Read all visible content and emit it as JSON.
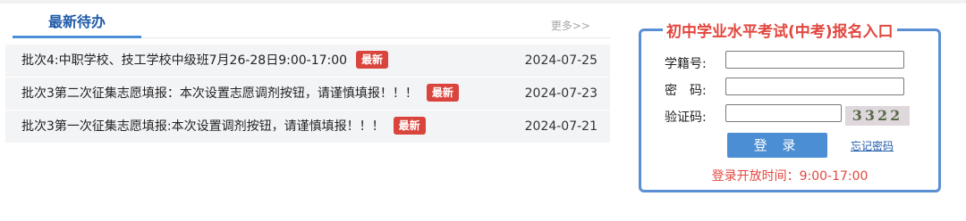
{
  "news": {
    "title": "最新待办",
    "more_label": "更多>>",
    "items": [
      {
        "title": "批次4:中职学校、技工学校中级班7月26-28日9:00-17:00",
        "badge": "最新",
        "date": "2024-07-25"
      },
      {
        "title": "批次3第二次征集志愿填报：本次设置志愿调剂按钮，请谨慎填报！！！",
        "badge": "最新",
        "date": "2024-07-23"
      },
      {
        "title": "批次3第一次征集志愿填报:本次设置调剂按钮，请谨慎填报！！！",
        "badge": "最新",
        "date": "2024-07-21"
      }
    ]
  },
  "registration": {
    "title": "初中学业水平考试(中考)报名入口",
    "student_id_label": "学籍号:",
    "password_label": "密　码:",
    "captcha_label": "验证码:",
    "captcha_text": "3322",
    "login_label": "登 录",
    "forgot_label": "忘记密码",
    "open_time": "登录开放时间：9:00-17:00"
  },
  "colors": {
    "accent_blue": "#4a90d9",
    "title_blue": "#1e5aa8",
    "badge_red": "#d9453d",
    "reg_red": "#e2473f"
  }
}
